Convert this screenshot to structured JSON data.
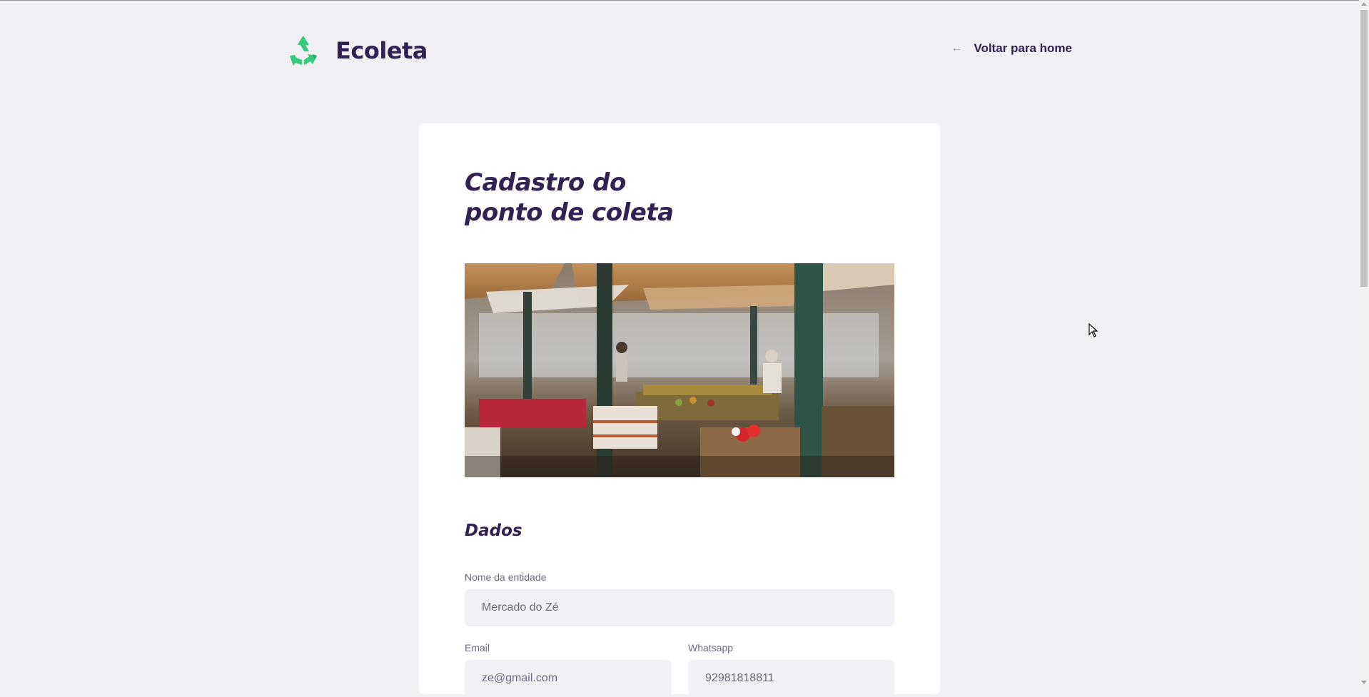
{
  "app": {
    "logo_text": "Ecoleta",
    "logo_icon": "recycle-icon",
    "back_link_label": "Voltar para home",
    "back_icon": "arrow-left-icon"
  },
  "colors": {
    "background": "#F0F0F5",
    "card": "#FFFFFF",
    "primary_text": "#322153",
    "muted_text": "#6C6C80",
    "accent_green": "#34CB79"
  },
  "form": {
    "title": "Cadastro do ponto de coleta",
    "title_line1": "Cadastro do",
    "title_line2": "ponto de coleta",
    "section_dados": "Dados",
    "fields": {
      "nome": {
        "label": "Nome da entidade",
        "placeholder": "Mercado do Zé"
      },
      "email": {
        "label": "Email",
        "placeholder": "ze@gmail.com"
      },
      "whatsapp": {
        "label": "Whatsapp",
        "placeholder": "92981818811"
      }
    }
  }
}
